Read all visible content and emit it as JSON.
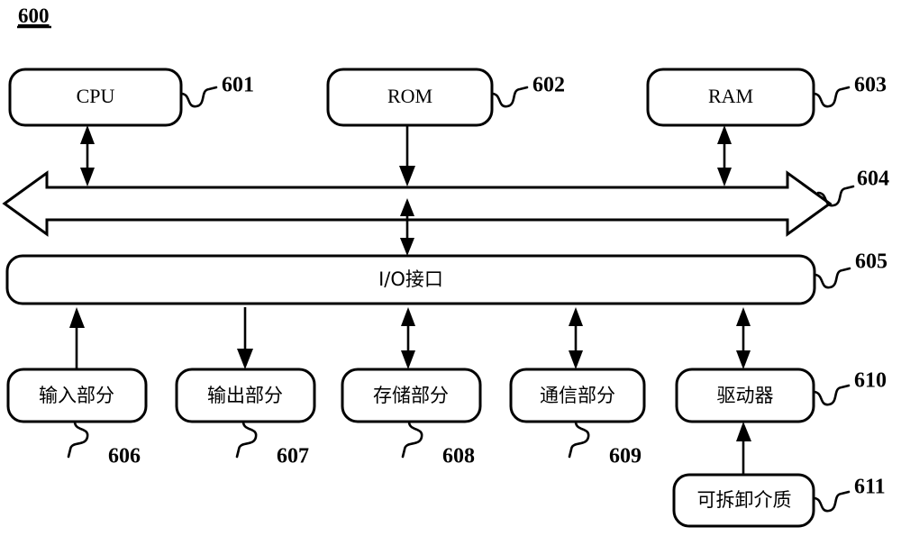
{
  "figure": {
    "number": "600",
    "title_label": "600"
  },
  "blocks": [
    {
      "id": "cpu",
      "label": "CPU",
      "ref": "601",
      "script": "latin"
    },
    {
      "id": "rom",
      "label": "ROM",
      "ref": "602",
      "script": "latin"
    },
    {
      "id": "ram",
      "label": "RAM",
      "ref": "603",
      "script": "latin"
    },
    {
      "id": "bus",
      "label": "",
      "ref": "604",
      "script": "none"
    },
    {
      "id": "io",
      "label": "I/O接口",
      "ref": "605",
      "script": "cjk"
    },
    {
      "id": "input",
      "label": "输入部分",
      "ref": "606",
      "script": "cjk"
    },
    {
      "id": "output",
      "label": "输出部分",
      "ref": "607",
      "script": "cjk"
    },
    {
      "id": "storage",
      "label": "存储部分",
      "ref": "608",
      "script": "cjk"
    },
    {
      "id": "comm",
      "label": "通信部分",
      "ref": "609",
      "script": "cjk"
    },
    {
      "id": "driver",
      "label": "驱动器",
      "ref": "610",
      "script": "cjk"
    },
    {
      "id": "media",
      "label": "可拆卸介质",
      "ref": "611",
      "script": "cjk"
    }
  ],
  "connections": [
    {
      "from": "cpu",
      "to": "bus",
      "type": "bidirectional"
    },
    {
      "from": "rom",
      "to": "bus",
      "type": "down"
    },
    {
      "from": "ram",
      "to": "bus",
      "type": "bidirectional"
    },
    {
      "from": "bus",
      "to": "io",
      "type": "bidirectional"
    },
    {
      "from": "io",
      "to": "input",
      "type": "up"
    },
    {
      "from": "io",
      "to": "output",
      "type": "down"
    },
    {
      "from": "io",
      "to": "storage",
      "type": "bidirectional"
    },
    {
      "from": "io",
      "to": "comm",
      "type": "bidirectional"
    },
    {
      "from": "io",
      "to": "driver",
      "type": "bidirectional"
    },
    {
      "from": "media",
      "to": "driver",
      "type": "up"
    }
  ],
  "colors": {
    "stroke": "#000000",
    "fill": "#ffffff",
    "background": "#ffffff"
  }
}
